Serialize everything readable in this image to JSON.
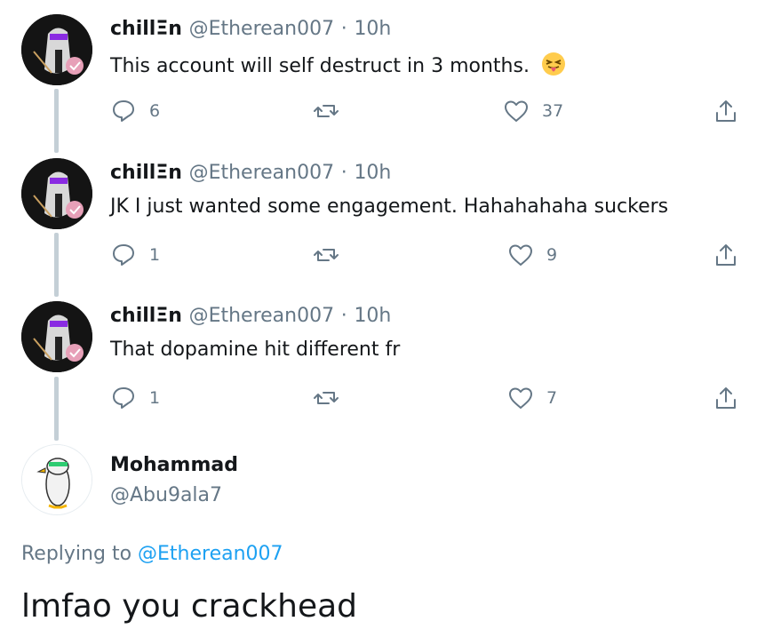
{
  "tweets": [
    {
      "display_name": "chillΞn",
      "handle": "@Etherean007",
      "time": "10h",
      "text": "This account will self destruct in 3 months.",
      "emoji": "squinting-face-with-tongue",
      "replies": "6",
      "retweets": "",
      "likes": "37"
    },
    {
      "display_name": "chillΞn",
      "handle": "@Etherean007",
      "time": "10h",
      "text": "JK I just wanted some engagement. Hahahahaha suckers",
      "replies": "1",
      "retweets": "",
      "likes": "9"
    },
    {
      "display_name": "chillΞn",
      "handle": "@Etherean007",
      "time": "10h",
      "text": "That dopamine hit different fr",
      "replies": "1",
      "retweets": "",
      "likes": "7"
    }
  ],
  "reply": {
    "display_name": "Mohammad",
    "handle": "@Abu9ala7",
    "replying_prefix": "Replying to",
    "replying_to": "@Etherean007",
    "text": "lmfao you crackhead"
  },
  "icons": {
    "reply": "reply-bubble-icon",
    "retweet": "retweet-icon",
    "like": "heart-icon",
    "share": "share-icon"
  },
  "colors": {
    "text": "#14171a",
    "secondary": "#657786",
    "link": "#1da1f2",
    "thread_line": "#c4cfd6"
  }
}
